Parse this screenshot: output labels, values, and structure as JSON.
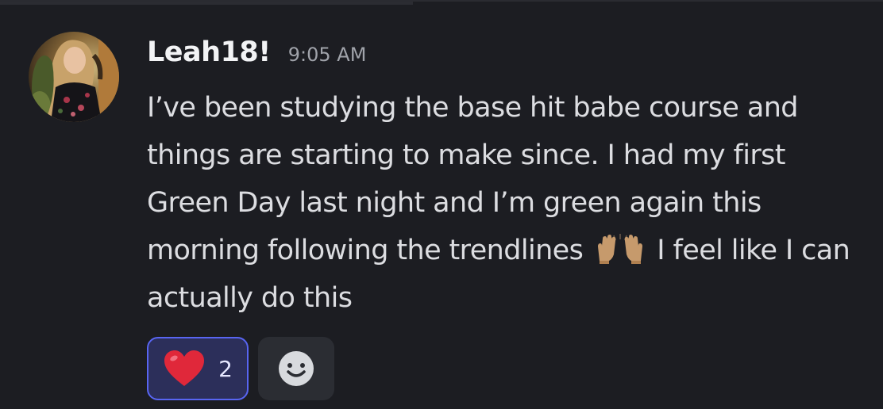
{
  "message": {
    "username": "Leah18!",
    "timestamp": "9:05 AM",
    "text_before_emoji": "I’ve been studying the base hit babe course and things are starting to make since. I had my first Green Day last night and I’m green again this morning following the trendlines",
    "emoji": "raising-hands-emoji",
    "text_after_emoji": "I feel like I can actually do this"
  },
  "reactions": [
    {
      "emoji": "heart-emoji",
      "count": "2",
      "selected": true
    }
  ],
  "add_reaction": {
    "icon": "smiley-icon"
  },
  "colors": {
    "background": "#1c1d22",
    "reaction_selected_border": "#5865f2",
    "reaction_selected_bg": "#2c2f5a",
    "username": "#f2f3f5",
    "text": "#dcdde1",
    "timestamp": "#a0a3aa"
  }
}
